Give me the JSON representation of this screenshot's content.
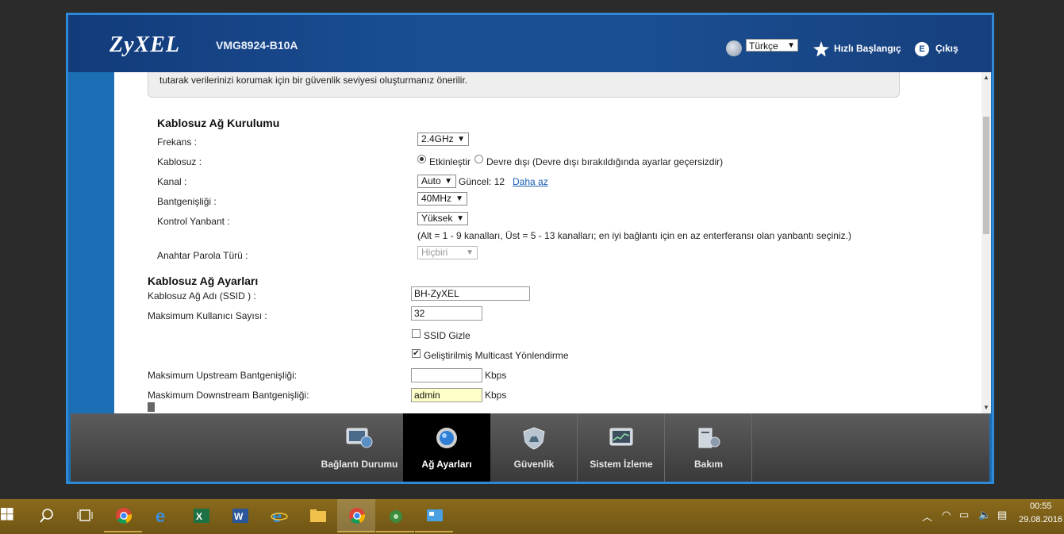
{
  "header": {
    "brand": "ZyXEL",
    "model": "VMG8924-B10A",
    "language": "Türkçe",
    "quick_start": "Hızlı Başlangıç",
    "logout": "Çıkış"
  },
  "notice": {
    "text": "tutarak verilerinizi korumak için bir güvenlik seviyesi oluşturmanız önerilir."
  },
  "wireless_setup": {
    "title": "Kablosuz Ağ Kurulumu",
    "frequency_label": "Frekans :",
    "frequency_value": "2.4GHz",
    "wireless_label": "Kablosuz :",
    "enable_label": "Etkinleştir",
    "disable_label": "Devre dışı (Devre dışı bırakıldığında ayarlar geçersizdir)",
    "channel_label": "Kanal :",
    "channel_value": "Auto",
    "current_channel": "Güncel: 12",
    "less_link": "Daha az",
    "bandwidth_label": "Bantgenişliği :",
    "bandwidth_value": "40MHz",
    "sideband_label": "Kontrol Yanbant :",
    "sideband_value": "Yüksek",
    "sideband_hint": "(Alt = 1 - 9 kanalları, Üst = 5 - 13 kanalları; en iyi bağlantı için en az enterferansı olan yanbantı seçiniz.)",
    "key_type_label": "Anahtar Parola Türü :",
    "key_type_value": "Hiçbiri"
  },
  "wireless_settings": {
    "title": "Kablosuz Ağ Ayarları",
    "ssid_label": "Kablosuz Ağ Adı (SSID ) :",
    "ssid_value": "BH-ZyXEL",
    "max_users_label": "Maksimum Kullanıcı Sayısı :",
    "max_users_value": "32",
    "hide_ssid_label": "SSID Gizle",
    "hide_ssid_checked": false,
    "multicast_label": "Geliştirilmiş Multicast Yönlendirme",
    "multicast_checked": true,
    "upstream_label": "Maksimum Upstream Bantgenişliği:",
    "upstream_value": "",
    "upstream_unit": "Kbps",
    "downstream_label": "Maskimum Downstream Bantgenişliği:",
    "downstream_value": "admin",
    "downstream_unit": "Kbps"
  },
  "bottom_nav": {
    "items": [
      {
        "label": "Bağlantı Durumu",
        "icon": "monitor-globe-icon"
      },
      {
        "label": "Ağ Ayarları",
        "icon": "gear-globe-icon",
        "active": true
      },
      {
        "label": "Güvenlik",
        "icon": "shield-icon"
      },
      {
        "label": "Sistem İzleme",
        "icon": "monitor-chart-icon"
      },
      {
        "label": "Bakım",
        "icon": "tools-icon"
      }
    ]
  },
  "taskbar": {
    "time": "00:55",
    "date": "29.08.2016"
  },
  "colors": {
    "header_blue": "#1b4f92",
    "frame_blue": "#1c6fb4",
    "taskbar": "#7a5e18",
    "link": "#1a5fb4",
    "highlight_input": "#ffffc8"
  }
}
